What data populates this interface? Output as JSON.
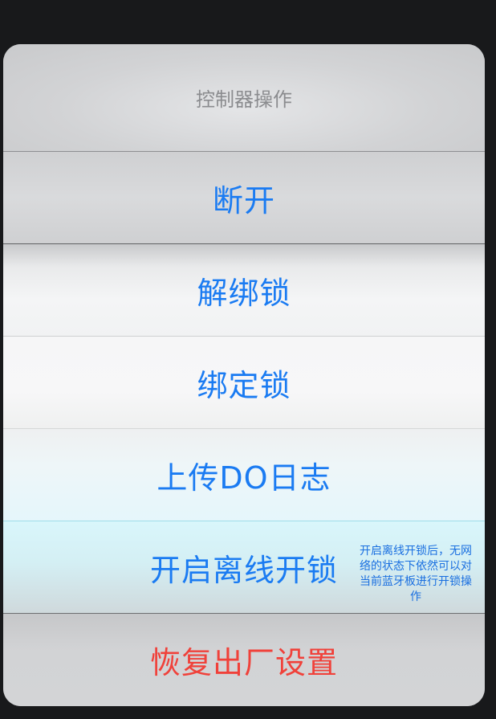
{
  "sheet": {
    "title": "控制器操作",
    "actions": [
      {
        "label": "断开",
        "style": "default"
      },
      {
        "label": "解绑锁",
        "style": "default"
      },
      {
        "label": "绑定锁",
        "style": "default"
      },
      {
        "label": "上传DO日志",
        "style": "default"
      },
      {
        "label": "开启离线开锁",
        "style": "default",
        "hint": "开启离线开锁后，无网络的状态下依然可以对当前蓝牙板进行开锁操作"
      },
      {
        "label": "恢复出厂设置",
        "style": "destructive"
      }
    ]
  },
  "colors": {
    "action_blue": "#1a7bf2",
    "destructive_red": "#f0413a",
    "title_gray": "#8b8c8f",
    "backdrop": "#18191b"
  }
}
